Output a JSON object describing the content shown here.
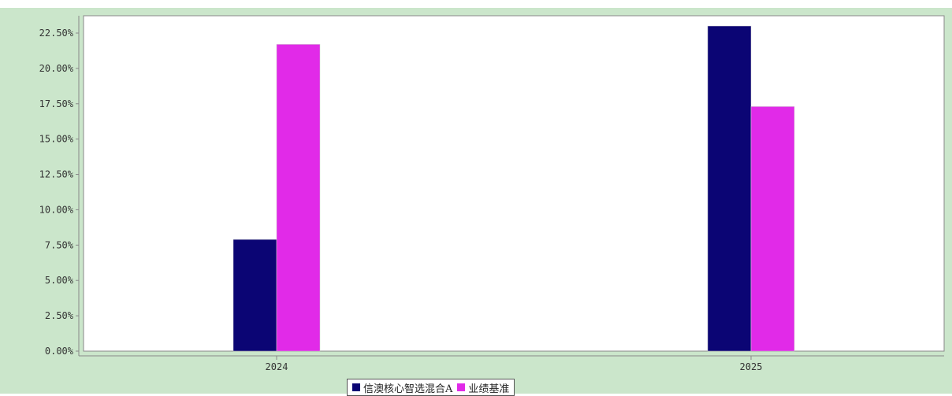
{
  "colors": {
    "background": "#cbe6cb",
    "plot_area": "#ffffff",
    "series_1": "#0b0574",
    "series_2": "#e12ae8"
  },
  "chart_data": {
    "type": "bar",
    "categories": [
      "2024",
      "2025"
    ],
    "series": [
      {
        "name": "信澳核心智选混合A",
        "values": [
          7.9,
          23.0
        ]
      },
      {
        "name": "业绩基准",
        "values": [
          21.7,
          17.3
        ]
      }
    ],
    "y_tick_labels": [
      "0.00%",
      "2.50%",
      "5.00%",
      "7.50%",
      "10.00%",
      "12.50%",
      "15.00%",
      "17.50%",
      "20.00%",
      "22.50%"
    ],
    "ylim": [
      0,
      22.5
    ],
    "grid": false,
    "legend_position": "bottom-center"
  }
}
